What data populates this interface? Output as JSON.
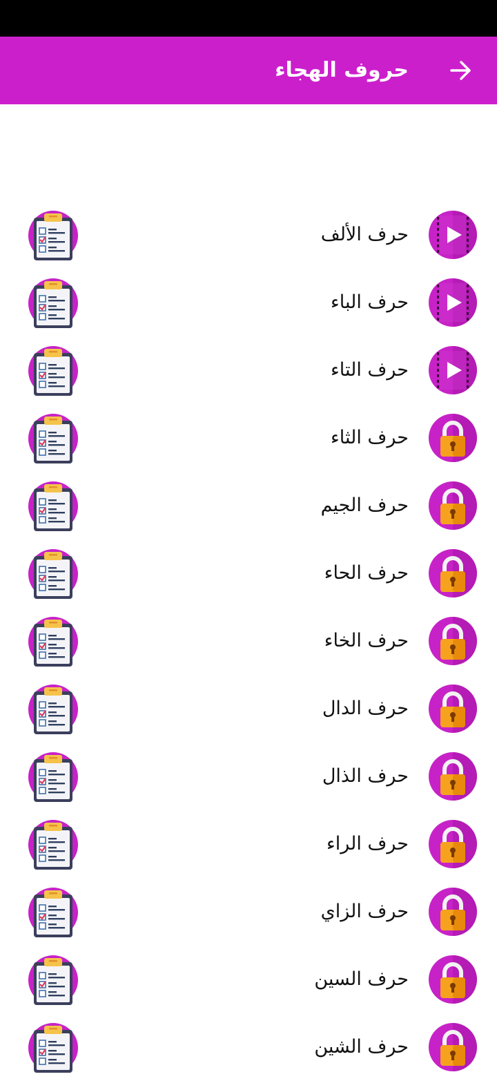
{
  "app_bar": {
    "title": "حروف الهجاء",
    "back_icon": "arrow-right-icon",
    "background": "#cc1fcc"
  },
  "letters": [
    {
      "label": "حرف الألف",
      "status": "play"
    },
    {
      "label": "حرف الباء",
      "status": "play"
    },
    {
      "label": "حرف التاء",
      "status": "play"
    },
    {
      "label": "حرف الثاء",
      "status": "locked"
    },
    {
      "label": "حرف الجيم",
      "status": "locked"
    },
    {
      "label": "حرف الحاء",
      "status": "locked"
    },
    {
      "label": "حرف الخاء",
      "status": "locked"
    },
    {
      "label": "حرف الدال",
      "status": "locked"
    },
    {
      "label": "حرف الذال",
      "status": "locked"
    },
    {
      "label": "حرف الراء",
      "status": "locked"
    },
    {
      "label": "حرف الزاي",
      "status": "locked"
    },
    {
      "label": "حرف السين",
      "status": "locked"
    },
    {
      "label": "حرف الشين",
      "status": "locked"
    }
  ],
  "icons": {
    "play": "play-video-icon",
    "locked": "lock-icon",
    "quiz": "quiz-clipboard-icon"
  },
  "colors": {
    "accent": "#cc1fcc",
    "lock_body": "#f6a21e",
    "lock_shackle": "#f2f2f2"
  }
}
